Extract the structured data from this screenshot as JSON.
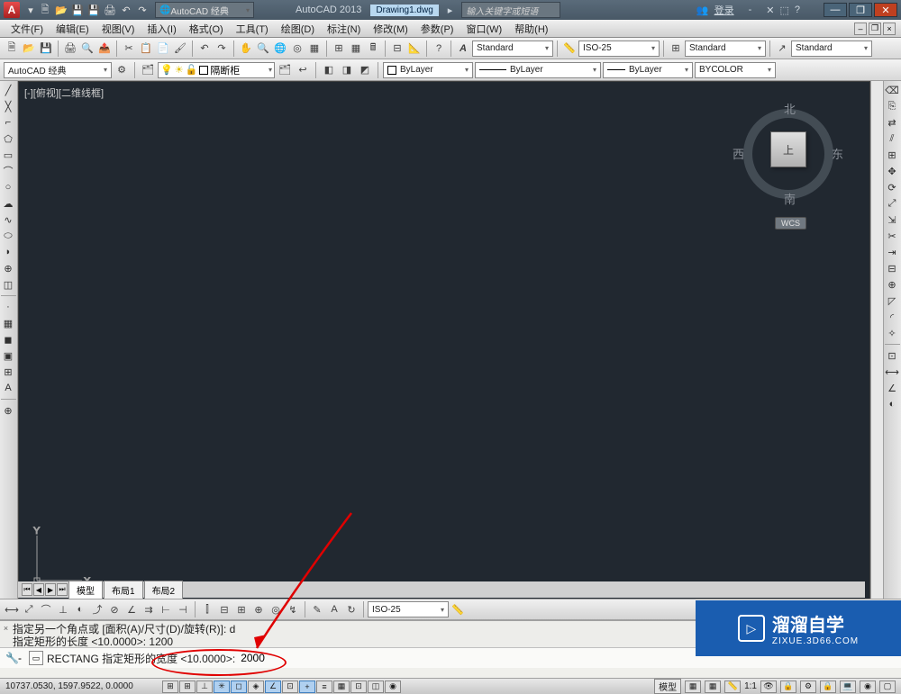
{
  "title": {
    "app": "AutoCAD 2013",
    "file": "Drawing1.dwg",
    "workspace": "AutoCAD 经典",
    "search_ph": "输入关键字或短语",
    "login": "登录"
  },
  "menu": [
    "文件(F)",
    "编辑(E)",
    "视图(V)",
    "插入(I)",
    "格式(O)",
    "工具(T)",
    "绘图(D)",
    "标注(N)",
    "修改(M)",
    "参数(P)",
    "窗口(W)",
    "帮助(H)"
  ],
  "row1": {
    "style1": "Standard",
    "style2": "ISO-25",
    "style3": "Standard",
    "style4": "Standard"
  },
  "row2": {
    "ws": "AutoCAD 经典",
    "layer_hint": "隔断柜",
    "color": "ByLayer",
    "ltype": "ByLayer",
    "lweight": "ByLayer",
    "plot": "BYCOLOR"
  },
  "viewport": {
    "label": "[-][俯视][二维线框]",
    "cube": "上",
    "n": "北",
    "s": "南",
    "e": "东",
    "w": "西",
    "wcs": "WCS"
  },
  "ucs": {
    "y": "Y",
    "x": "X"
  },
  "tabs": [
    "模型",
    "布局1",
    "布局2"
  ],
  "dimbar": {
    "style": "ISO-25"
  },
  "cmd": {
    "hist1": "指定另一个角点或 [面积(A)/尺寸(D)/旋转(R)]: d",
    "hist2": "指定矩形的长度 <10.0000>: 1200",
    "prompt": "RECTANG 指定矩形的宽度 <10.0000>:",
    "input": "2000"
  },
  "status": {
    "coords": "10737.0530, 1597.9522, 0.0000",
    "scale": "1:1",
    "model": "模型"
  },
  "watermark": {
    "main": "溜溜自学",
    "sub": "ZIXUE.3D66.COM"
  }
}
